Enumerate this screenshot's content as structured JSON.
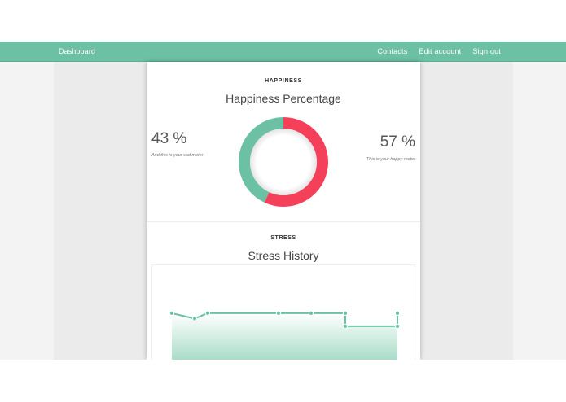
{
  "navbar": {
    "brand": "Dashboard",
    "links": [
      "Contacts",
      "Edit account",
      "Sign out"
    ],
    "color": "#6cc1a5"
  },
  "happiness": {
    "section_label": "HAPPINESS",
    "title": "Happiness Percentage",
    "sad_value": "43 %",
    "sad_caption": "And this is your sad meter",
    "happy_value": "57 %",
    "happy_caption": "This is your happy meter",
    "sad_color": "#6cc1a5",
    "happy_color": "#f5405a"
  },
  "stress": {
    "section_label": "STRESS",
    "title": "Stress History",
    "line_color": "#6cc1a5"
  },
  "chart_data": [
    {
      "type": "pie",
      "title": "Happiness Percentage",
      "categories": [
        "sad",
        "happy"
      ],
      "values": [
        43,
        57
      ],
      "colors": [
        "#6cc1a5",
        "#f5405a"
      ]
    },
    {
      "type": "area",
      "title": "Stress History",
      "x": [
        1,
        2,
        3,
        4,
        5,
        6,
        7,
        8
      ],
      "values": [
        6.5,
        5.8,
        6.5,
        6.5,
        6.5,
        6.5,
        4.8,
        6.5
      ],
      "ylim": [
        0,
        10
      ]
    }
  ]
}
